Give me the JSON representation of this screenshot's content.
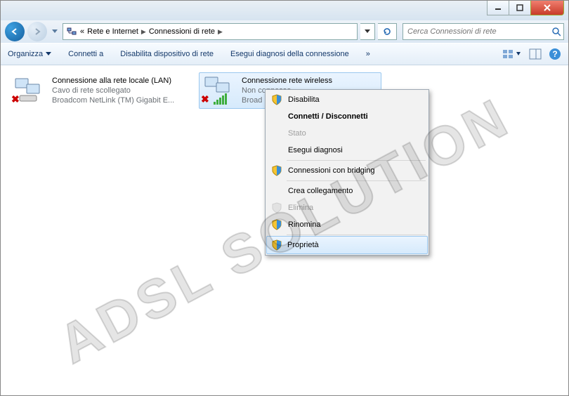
{
  "breadcrumb": {
    "root_marker": "«",
    "p1": "Rete e Internet",
    "p2": "Connessioni di rete"
  },
  "search": {
    "placeholder": "Cerca Connessioni di rete"
  },
  "cmdbar": {
    "organize": "Organizza",
    "connect": "Connetti a",
    "disable": "Disabilita dispositivo di rete",
    "diagnose": "Esegui diagnosi della connessione",
    "more": "»"
  },
  "items": [
    {
      "title": "Connessione alla rete locale (LAN)",
      "status": "Cavo di rete scollegato",
      "device": "Broadcom NetLink (TM) Gigabit E..."
    },
    {
      "title": "Connessione rete wireless",
      "status": "Non connesso",
      "device": "Broad"
    }
  ],
  "ctx": {
    "disable": "Disabilita",
    "connect": "Connetti / Disconnetti",
    "state": "Stato",
    "diag": "Esegui diagnosi",
    "bridge": "Connessioni con bridging",
    "shortcut": "Crea collegamento",
    "delete": "Elimina",
    "rename": "Rinomina",
    "props": "Proprietà"
  },
  "watermark": "ADSL SOLUTION"
}
